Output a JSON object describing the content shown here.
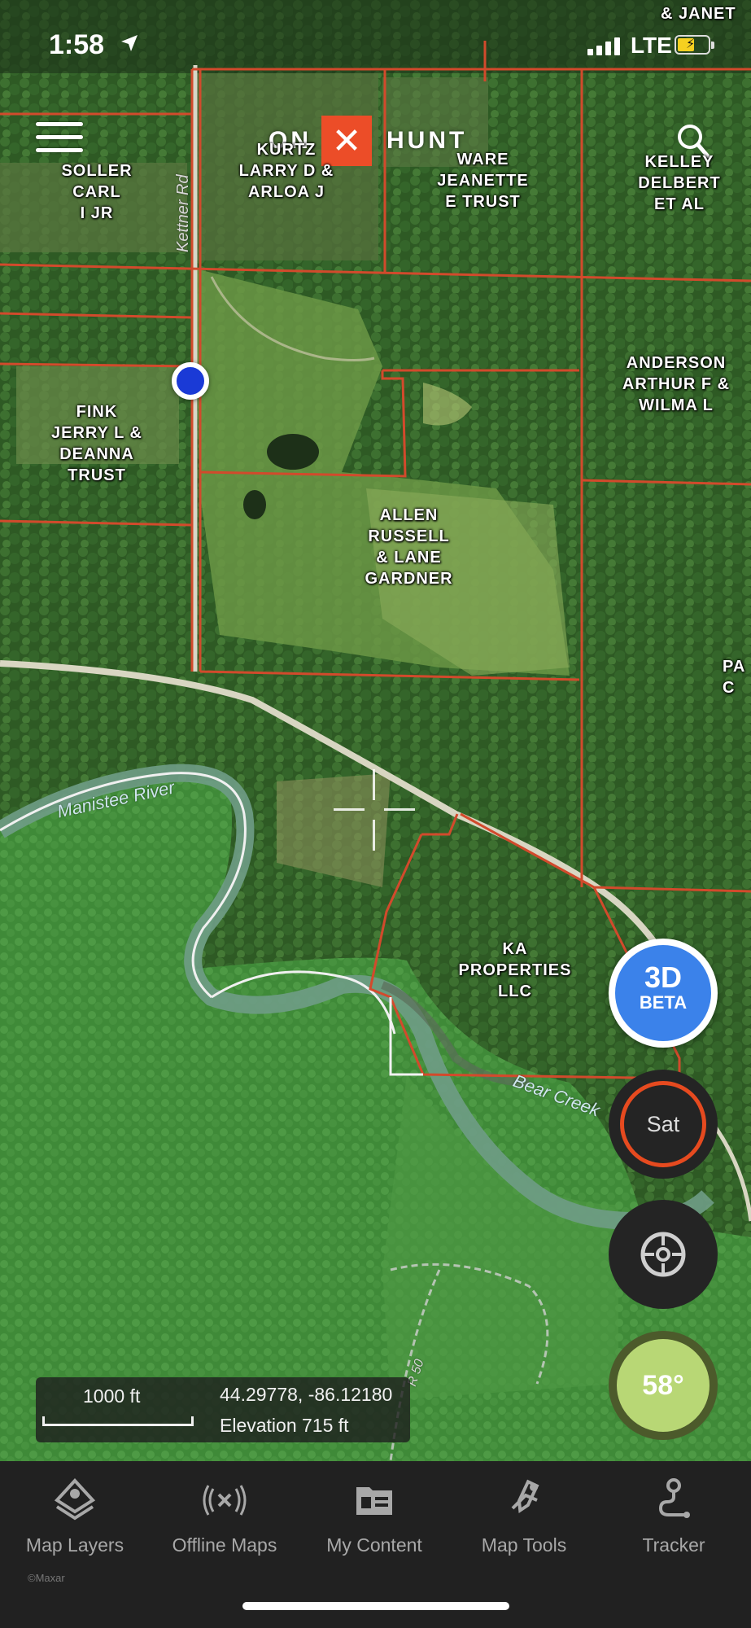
{
  "status_bar": {
    "time": "1:58",
    "carrier": "LTE",
    "battery_level": 0.55,
    "location_icon": "location-arrow-icon"
  },
  "header": {
    "logo_left": "ON",
    "logo_mark": "✕",
    "logo_right": "HUNT",
    "menu_icon": "hamburger-menu-icon",
    "search_icon": "search-icon"
  },
  "parcels": [
    "SOLLER\nCARL\nI JR",
    "KURTZ\nLARRY D &\nARLOA J",
    "WARE\nJEANETTE\nE TRUST",
    "KELLEY\nDELBERT\nET AL",
    "ANDERSON\nARTHUR F &\nWILMA L",
    "FINK\nJERRY L &\nDEANNA\nTRUST",
    "ALLEN\nRUSSELL\n& LANE\nGARDNER",
    "KA\nPROPERTIES\nLLC",
    "PA\nC",
    "& JANET"
  ],
  "map_labels": {
    "road": "Kettner Rd",
    "river": "Manistee River",
    "creek": "Bear Creek",
    "trail": "R 50"
  },
  "buttons": {
    "three_d": "3D",
    "three_d_sub": "BETA",
    "sat": "Sat",
    "temperature": "58°"
  },
  "info": {
    "scale": "1000 ft",
    "coordinates": "44.29778, -86.12180",
    "elevation": "Elevation 715 ft"
  },
  "nav": [
    {
      "label": "Map Layers",
      "icon": "map-layers-icon"
    },
    {
      "label": "Offline Maps",
      "icon": "offline-maps-icon"
    },
    {
      "label": "My Content",
      "icon": "my-content-icon"
    },
    {
      "label": "Map Tools",
      "icon": "map-tools-icon"
    },
    {
      "label": "Tracker",
      "icon": "tracker-icon"
    }
  ],
  "credit": "©Maxar",
  "colors": {
    "parcel_line": "#d24a2c",
    "accent": "#ec4d28",
    "three_d_blue": "#3b82ea",
    "location_blue": "#1a3ad6"
  }
}
